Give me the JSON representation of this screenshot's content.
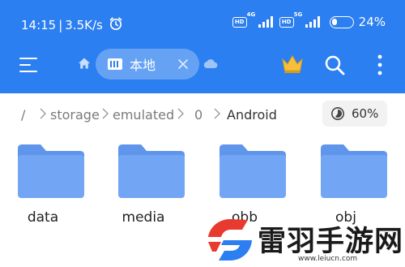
{
  "status_bar": {
    "time": "14:15",
    "separator": "|",
    "speed": "3.5K/s",
    "sim1_hd": "HD",
    "sim1_network": "4G",
    "sim2_hd": "HD",
    "sim2_network": "5G",
    "battery_percent": "24%",
    "battery_level": 0.24
  },
  "toolbar": {
    "tab_label": "本地",
    "icons": [
      "menu-icon",
      "home-icon",
      "drive-icon",
      "close-icon",
      "cloud-icon",
      "crown-icon",
      "search-icon",
      "more-icon"
    ]
  },
  "breadcrumb": {
    "root": "/",
    "items": [
      "storage",
      "emulated",
      "0",
      "Android"
    ]
  },
  "storage_usage": {
    "label": "60%",
    "fraction": 0.6
  },
  "folders": [
    {
      "name": "data"
    },
    {
      "name": "media"
    },
    {
      "name": "obb"
    },
    {
      "name": "obj"
    }
  ],
  "watermark": {
    "text": "雷羽手游网",
    "domain": "www.leiucn.com"
  },
  "colors": {
    "accent": "#2c7ff0",
    "folder": "#72a6f5",
    "folder_tab": "#5f95ea",
    "crown": "#f6c03d",
    "watermark_red": "#e83a2f",
    "watermark_blue": "#2c7ff0"
  }
}
